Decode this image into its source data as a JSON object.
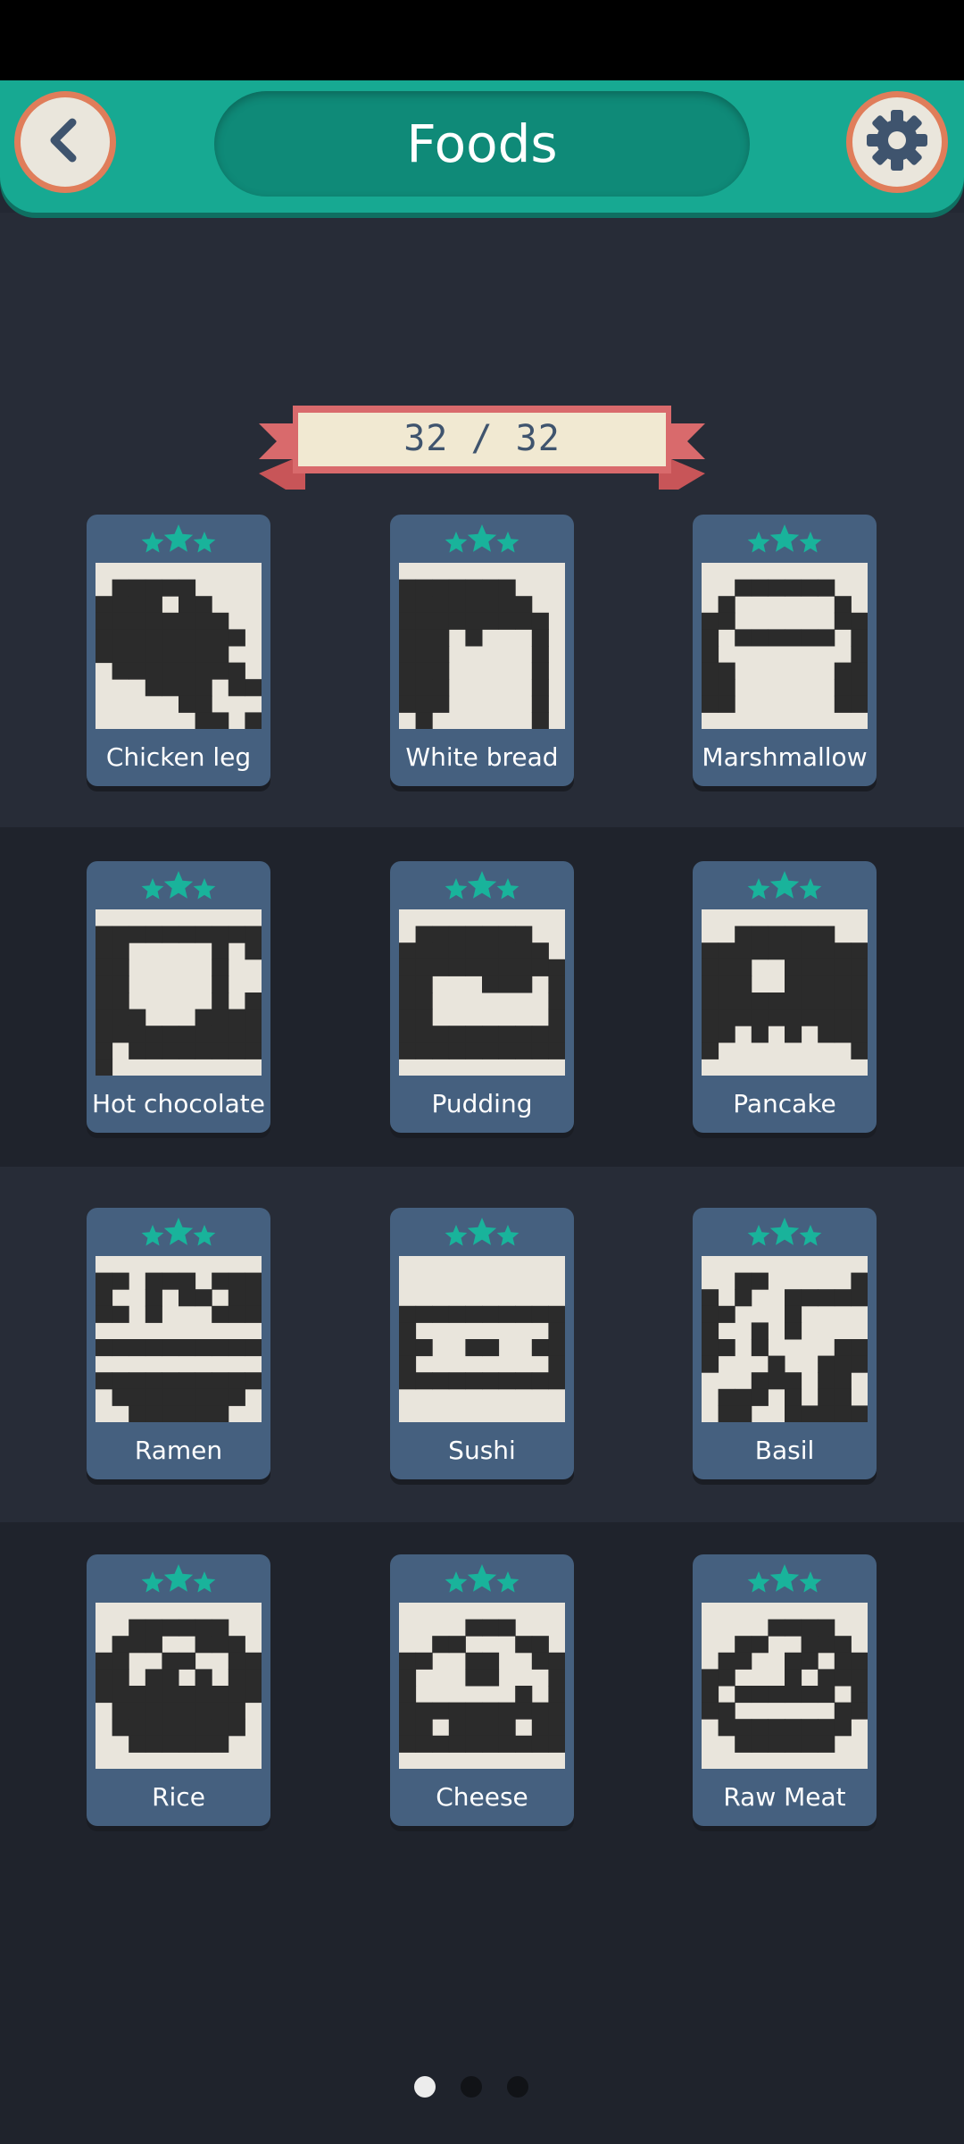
{
  "header": {
    "title": "Foods",
    "back_icon": "chevron-left-icon",
    "settings_icon": "gear-icon"
  },
  "progress": {
    "label": "32 / 32",
    "completed": 32,
    "total": 32
  },
  "colors": {
    "accent": "#17a992",
    "star": "#19b39b",
    "card": "#45607f",
    "pixel_dark": "#2b2b2b",
    "pixel_light": "#e9e5dc",
    "button_ring": "#e07d5a"
  },
  "puzzles": [
    {
      "name": "Chicken leg",
      "stars": 3,
      "grid": [
        "0000000000",
        "0111110000",
        "1111011000",
        "1111111100",
        "1111111110",
        "1111111100",
        "0111111110",
        "0001111011",
        "0000011000",
        "0000001101"
      ]
    },
    {
      "name": "White bread",
      "stars": 3,
      "grid": [
        "0000000000",
        "1111111000",
        "1111111100",
        "1111111110",
        "1110100010",
        "1110000010",
        "1110000010",
        "1110000010",
        "1110000010",
        "0100000010"
      ]
    },
    {
      "name": "Marshmallow",
      "stars": 3,
      "grid": [
        "0000000000",
        "0011111100",
        "0100000010",
        "1100000011",
        "1011111101",
        "1000000001",
        "1100000011",
        "1100000011",
        "1100000011",
        "0000000000"
      ]
    },
    {
      "name": "Hot chocolate",
      "stars": 3,
      "grid": [
        "0000000000",
        "1111111111",
        "1100000101",
        "1100000100",
        "1100000100",
        "1100000101",
        "1110001111",
        "1111111111",
        "1011111111",
        "1000000000"
      ]
    },
    {
      "name": "Pudding",
      "stars": 3,
      "grid": [
        "0000000000",
        "0111111100",
        "1111111110",
        "1111111111",
        "1100011101",
        "1100000001",
        "1100000001",
        "1111111111",
        "1111111111",
        "0000000000"
      ]
    },
    {
      "name": "Pancake",
      "stars": 3,
      "grid": [
        "0000000000",
        "0011111100",
        "1111111111",
        "1110011111",
        "1110011111",
        "1111111111",
        "1111111111",
        "1101010111",
        "1000000001",
        "0000000000"
      ]
    },
    {
      "name": "Ramen",
      "stars": 3,
      "grid": [
        "0000000000",
        "1101110111",
        "1001011011",
        "1101000111",
        "0000000000",
        "1111111111",
        "0000000000",
        "1111111111",
        "0111111110",
        "0011111100"
      ]
    },
    {
      "name": "Sushi",
      "stars": 3,
      "grid": [
        "0000000000",
        "0000000000",
        "0000000000",
        "1111111111",
        "1000000001",
        "1100110011",
        "1000000001",
        "1111111111",
        "0000000000",
        "0000000000"
      ]
    },
    {
      "name": "Basil",
      "stars": 3,
      "grid": [
        "0000000000",
        "0011000001",
        "1010011111",
        "1100010000",
        "1001010000",
        "1101000011",
        "1000100111",
        "0001110110",
        "0111010110",
        "0110011111"
      ]
    },
    {
      "name": "Rice",
      "stars": 3,
      "grid": [
        "0000000000",
        "0011111100",
        "0111001110",
        "1100110011",
        "1101101011",
        "1111111111",
        "0111111110",
        "0111111110",
        "0011111100",
        "0000000000"
      ]
    },
    {
      "name": "Cheese",
      "stars": 3,
      "grid": [
        "0000000000",
        "0000111000",
        "0011000110",
        "1100110011",
        "1000110001",
        "1000000101",
        "1111111111",
        "1101111011",
        "1111111111",
        "0000000000"
      ]
    },
    {
      "name": "Raw Meat",
      "stars": 3,
      "grid": [
        "0000000000",
        "0000111100",
        "0011001110",
        "0110011011",
        "1100010111",
        "1011111101",
        "1100000011",
        "0111111110",
        "0011111100",
        "0000000000"
      ]
    }
  ],
  "pagination": {
    "current": 1,
    "pages": 3
  }
}
